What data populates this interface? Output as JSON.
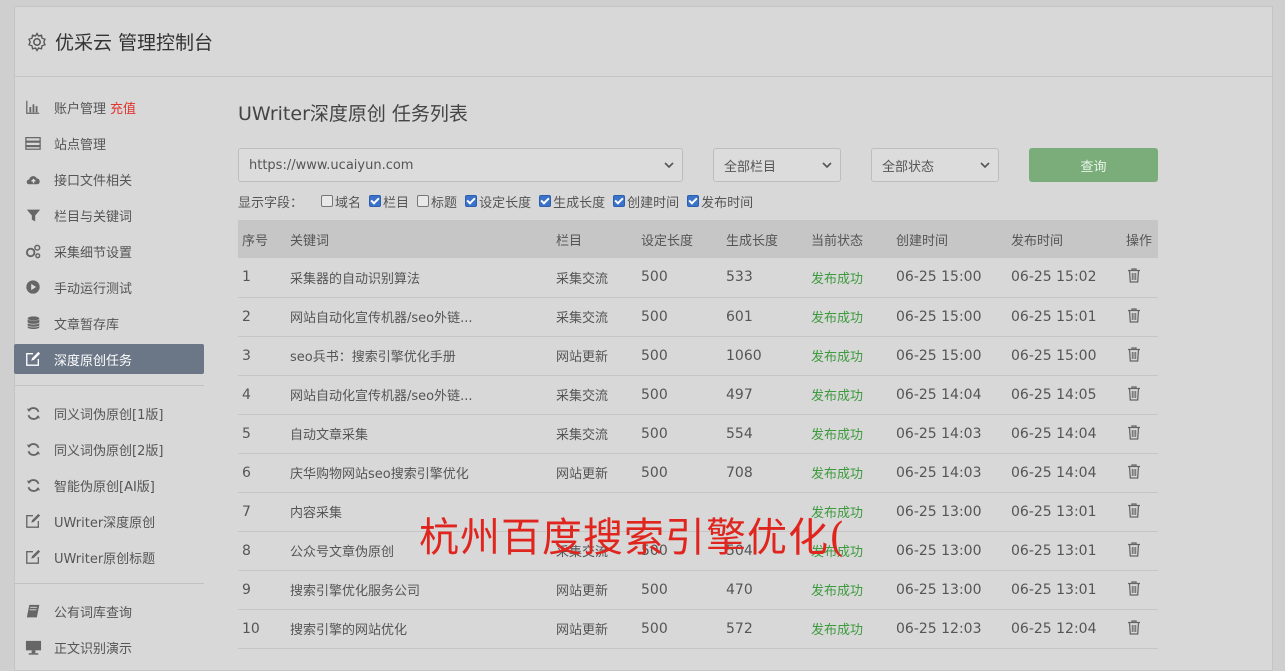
{
  "header": {
    "title": "优采云 管理控制台"
  },
  "sidebar": {
    "group1": [
      {
        "label": "账户管理",
        "extra": "充值",
        "icon": "bar-chart-icon"
      },
      {
        "label": "站点管理",
        "icon": "server-icon"
      },
      {
        "label": "接口文件相关",
        "icon": "cloud-upload-icon"
      },
      {
        "label": "栏目与关键词",
        "icon": "filter-icon"
      },
      {
        "label": "采集细节设置",
        "icon": "gears-icon"
      },
      {
        "label": "手动运行测试",
        "icon": "play-icon"
      },
      {
        "label": "文章暂存库",
        "icon": "database-icon"
      },
      {
        "label": "深度原创任务",
        "icon": "edit-icon",
        "active": true
      }
    ],
    "group2": [
      {
        "label": "同义词伪原创[1版]",
        "icon": "refresh-icon"
      },
      {
        "label": "同义词伪原创[2版]",
        "icon": "refresh-icon"
      },
      {
        "label": "智能伪原创[AI版]",
        "icon": "refresh-icon"
      },
      {
        "label": "UWriter深度原创",
        "icon": "edit-icon"
      },
      {
        "label": "UWriter原创标题",
        "icon": "edit-icon"
      }
    ],
    "group3": [
      {
        "label": "公有词库查询",
        "icon": "book-icon"
      },
      {
        "label": "正文识别演示",
        "icon": "monitor-icon"
      }
    ]
  },
  "main": {
    "title": "UWriter深度原创 任务列表",
    "site_select": "https://www.ucaiyun.com",
    "category_select": "全部栏目",
    "status_select": "全部状态",
    "query_button": "查询",
    "fields_label": "显示字段：",
    "fields": [
      {
        "label": "域名",
        "checked": false
      },
      {
        "label": "栏目",
        "checked": true
      },
      {
        "label": "标题",
        "checked": false
      },
      {
        "label": "设定长度",
        "checked": true
      },
      {
        "label": "生成长度",
        "checked": true
      },
      {
        "label": "创建时间",
        "checked": true
      },
      {
        "label": "发布时间",
        "checked": true
      }
    ],
    "columns": [
      "序号",
      "关键词",
      "栏目",
      "设定长度",
      "生成长度",
      "当前状态",
      "创建时间",
      "发布时间",
      "操作"
    ],
    "rows": [
      [
        "1",
        "采集器的自动识别算法",
        "采集交流",
        "500",
        "533",
        "发布成功",
        "06-25 15:00",
        "06-25 15:02"
      ],
      [
        "2",
        "网站自动化宣传机器/seo外链...",
        "采集交流",
        "500",
        "601",
        "发布成功",
        "06-25 15:00",
        "06-25 15:01"
      ],
      [
        "3",
        "seo兵书：搜索引擎优化手册",
        "网站更新",
        "500",
        "1060",
        "发布成功",
        "06-25 15:00",
        "06-25 15:00"
      ],
      [
        "4",
        "网站自动化宣传机器/seo外链...",
        "采集交流",
        "500",
        "497",
        "发布成功",
        "06-25 14:04",
        "06-25 14:05"
      ],
      [
        "5",
        "自动文章采集",
        "采集交流",
        "500",
        "554",
        "发布成功",
        "06-25 14:03",
        "06-25 14:04"
      ],
      [
        "6",
        "庆华购物网站seo搜索引擎优化",
        "网站更新",
        "500",
        "708",
        "发布成功",
        "06-25 14:03",
        "06-25 14:04"
      ],
      [
        "7",
        "内容采集",
        "",
        "",
        "",
        "发布成功",
        "06-25 13:00",
        "06-25 13:01"
      ],
      [
        "8",
        "公众号文章伪原创",
        "采集交流",
        "500",
        "504",
        "发布成功",
        "06-25 13:00",
        "06-25 13:01"
      ],
      [
        "9",
        "搜索引擎优化服务公司",
        "网站更新",
        "500",
        "470",
        "发布成功",
        "06-25 13:00",
        "06-25 13:01"
      ],
      [
        "10",
        "搜索引擎的网站优化",
        "网站更新",
        "500",
        "572",
        "发布成功",
        "06-25 12:03",
        "06-25 12:04"
      ]
    ]
  },
  "watermark": "杭州百度搜索引擎优化(",
  "colors": {
    "accent": "#7aad7a",
    "status_ok": "#3d9a3d",
    "watermark": "#e0251e",
    "active_nav": "#6b7686"
  }
}
